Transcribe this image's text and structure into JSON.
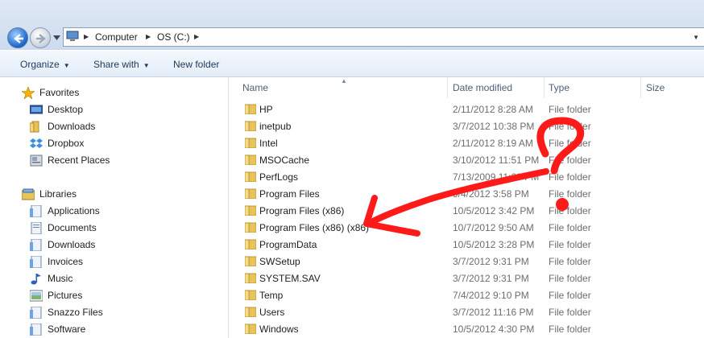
{
  "address": {
    "crumbs": [
      "Computer",
      "OS (C:)"
    ]
  },
  "toolbar": {
    "organize": "Organize",
    "share_with": "Share with",
    "new_folder": "New folder"
  },
  "nav": {
    "favorites_header": "Favorites",
    "favorites": [
      "Desktop",
      "Downloads",
      "Dropbox",
      "Recent Places"
    ],
    "libraries_header": "Libraries",
    "libraries": [
      "Applications",
      "Documents",
      "Downloads",
      "Invoices",
      "Music",
      "Pictures",
      "Snazzo Files",
      "Software"
    ]
  },
  "columns": {
    "name": "Name",
    "date": "Date modified",
    "type": "Type",
    "size": "Size"
  },
  "rows": [
    {
      "name": "HP",
      "date": "2/11/2012 8:28 AM",
      "type": "File folder"
    },
    {
      "name": "inetpub",
      "date": "3/7/2012 10:38 PM",
      "type": "File folder"
    },
    {
      "name": "Intel",
      "date": "2/11/2012 8:19 AM",
      "type": "File folder"
    },
    {
      "name": "MSOCache",
      "date": "3/10/2012 11:51 PM",
      "type": "File folder"
    },
    {
      "name": "PerfLogs",
      "date": "7/13/2009 11:20 PM",
      "type": "File folder"
    },
    {
      "name": "Program Files",
      "date": "9/4/2012 3:58 PM",
      "type": "File folder"
    },
    {
      "name": "Program Files (x86)",
      "date": "10/5/2012 3:42 PM",
      "type": "File folder"
    },
    {
      "name": "Program Files (x86) (x86)",
      "date": "10/7/2012 9:50 AM",
      "type": "File folder"
    },
    {
      "name": "ProgramData",
      "date": "10/5/2012 3:28 PM",
      "type": "File folder"
    },
    {
      "name": "SWSetup",
      "date": "3/7/2012 9:31 PM",
      "type": "File folder"
    },
    {
      "name": "SYSTEM.SAV",
      "date": "3/7/2012 9:31 PM",
      "type": "File folder"
    },
    {
      "name": "Temp",
      "date": "7/4/2012 9:10 PM",
      "type": "File folder"
    },
    {
      "name": "Users",
      "date": "3/7/2012 11:16 PM",
      "type": "File folder"
    },
    {
      "name": "Windows",
      "date": "10/5/2012 4:30 PM",
      "type": "File folder"
    }
  ],
  "colors": {
    "annotation": "#ff1a1a",
    "folder": "#e8c25a",
    "header_text": "#4c607a"
  }
}
